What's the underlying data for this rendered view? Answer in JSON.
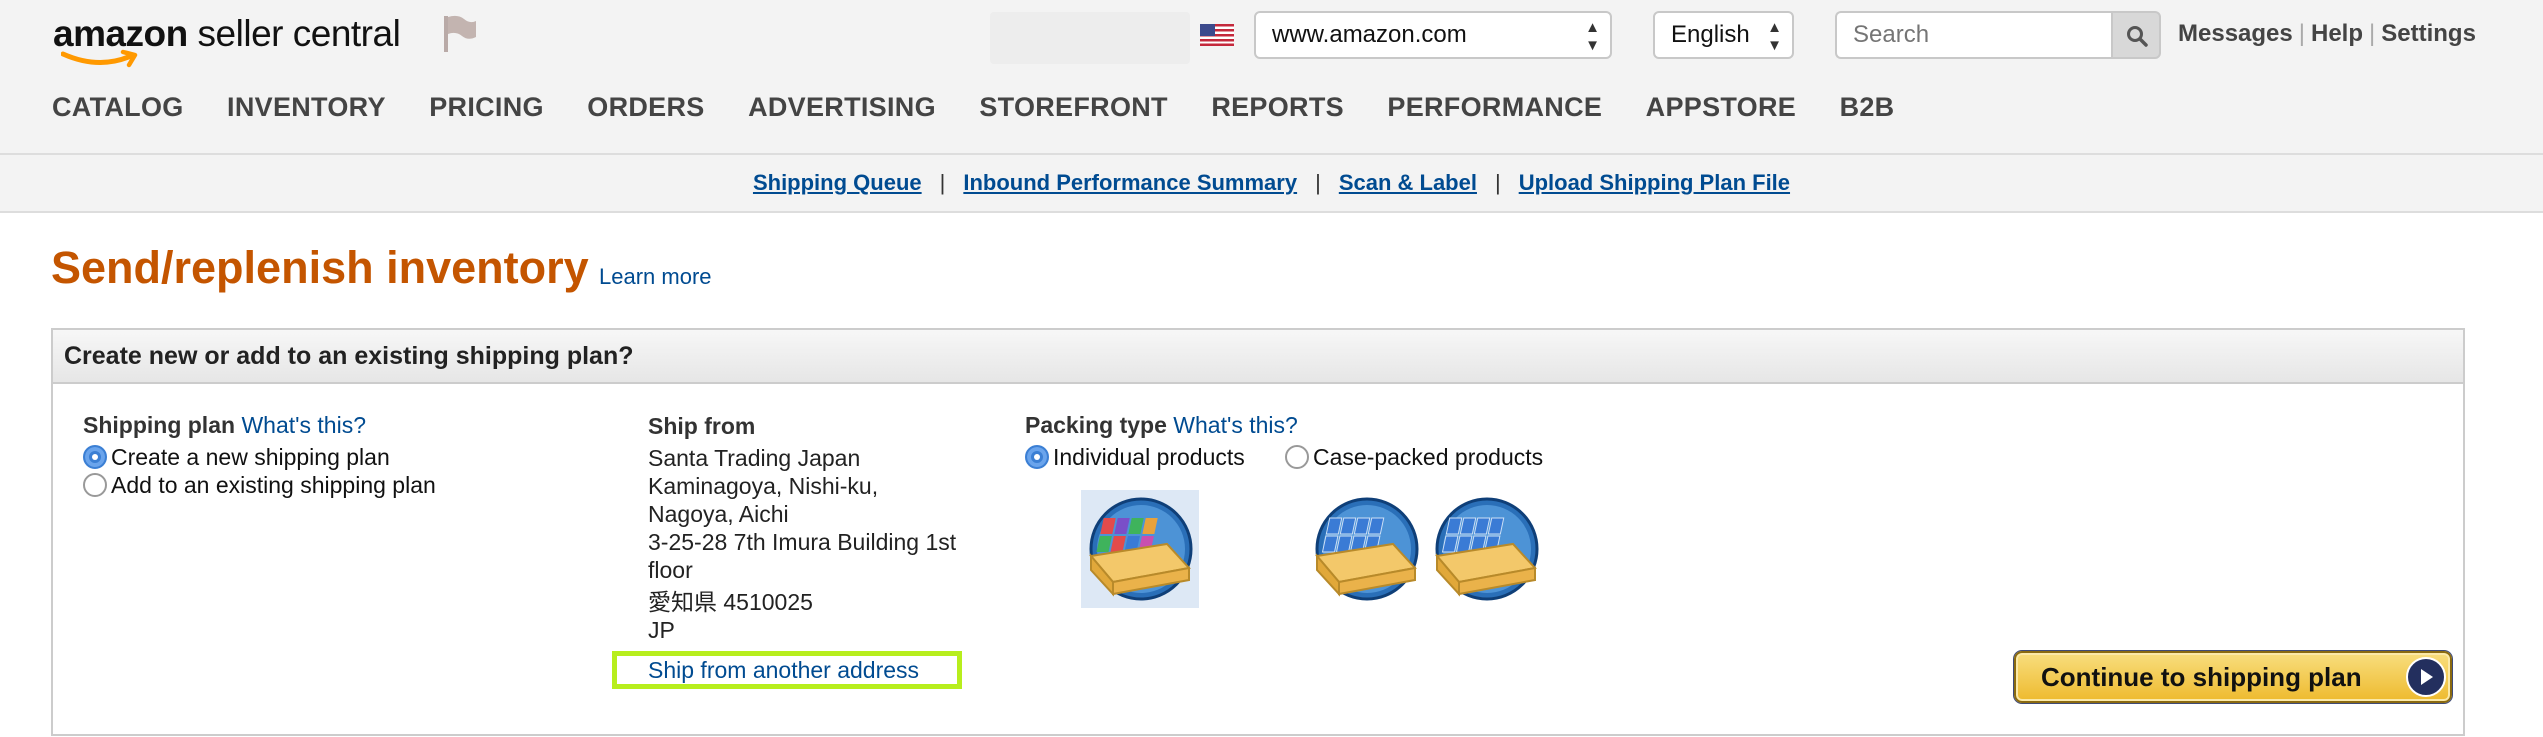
{
  "header": {
    "logo_brand": "amazon",
    "logo_product": "seller central",
    "marketplace": "www.amazon.com",
    "language": "English",
    "search_placeholder": "Search",
    "links": {
      "messages": "Messages",
      "help": "Help",
      "settings": "Settings"
    }
  },
  "main_nav": [
    "CATALOG",
    "INVENTORY",
    "PRICING",
    "ORDERS",
    "ADVERTISING",
    "STOREFRONT",
    "REPORTS",
    "PERFORMANCE",
    "APPSTORE",
    "B2B"
  ],
  "sub_nav": [
    "Shipping Queue",
    "Inbound Performance Summary",
    "Scan & Label",
    "Upload Shipping Plan File"
  ],
  "page": {
    "title": "Send/replenish inventory",
    "learn_more": "Learn more"
  },
  "panel": {
    "heading": "Create new or add to an existing shipping plan?",
    "shipping_plan": {
      "label": "Shipping plan",
      "help": "What's this?",
      "options": [
        {
          "label": "Create a new shipping plan",
          "selected": true
        },
        {
          "label": "Add to an existing shipping plan",
          "selected": false
        }
      ]
    },
    "ship_from": {
      "label": "Ship from",
      "address_lines": [
        "Santa Trading Japan",
        "Kaminagoya, Nishi-ku,",
        "Nagoya, Aichi",
        "3-25-28 7th Imura Building 1st",
        "floor",
        "愛知県 4510025",
        "JP"
      ],
      "change_link": "Ship from another address"
    },
    "packing_type": {
      "label": "Packing type",
      "help": "What's this?",
      "options": [
        {
          "label": "Individual products",
          "selected": true
        },
        {
          "label": "Case-packed products",
          "selected": false
        }
      ]
    },
    "continue_button": "Continue to shipping plan"
  },
  "colors": {
    "title_orange": "#c45500",
    "link_blue": "#004b91",
    "highlight_green": "#b7ee1d",
    "button_gold": "#f0c14b"
  }
}
